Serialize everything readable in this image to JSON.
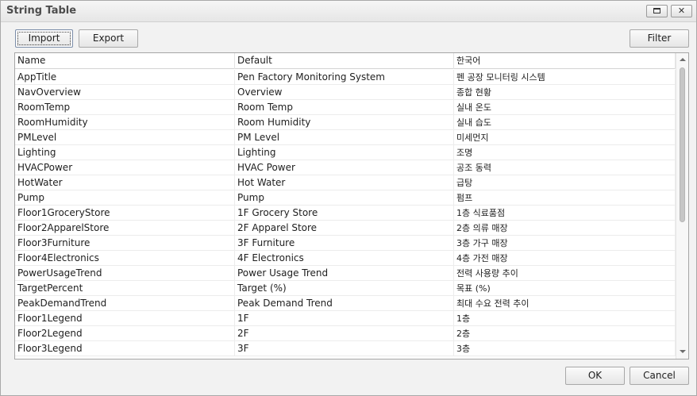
{
  "window": {
    "title": "String Table"
  },
  "toolbar": {
    "import_label": "Import",
    "export_label": "Export",
    "filter_label": "Filter"
  },
  "footer": {
    "ok_label": "OK",
    "cancel_label": "Cancel"
  },
  "table": {
    "columns": [
      "Name",
      "Default",
      "한국어"
    ],
    "rows": [
      [
        "AppTitle",
        "Pen Factory Monitoring System",
        "펜 공장 모니터링 시스템"
      ],
      [
        "NavOverview",
        "Overview",
        "종합 현황"
      ],
      [
        "RoomTemp",
        "Room Temp",
        "실내 온도"
      ],
      [
        "RoomHumidity",
        "Room Humidity",
        "실내 습도"
      ],
      [
        "PMLevel",
        "PM Level",
        "미세먼지"
      ],
      [
        "Lighting",
        "Lighting",
        "조명"
      ],
      [
        "HVACPower",
        "HVAC Power",
        "공조 동력"
      ],
      [
        "HotWater",
        "Hot Water",
        "급탕"
      ],
      [
        "Pump",
        "Pump",
        "펌프"
      ],
      [
        "Floor1GroceryStore",
        "1F Grocery Store",
        "1층 식료품점"
      ],
      [
        "Floor2ApparelStore",
        "2F Apparel Store",
        "2층 의류 매장"
      ],
      [
        "Floor3Furniture",
        "3F Furniture",
        "3층 가구 매장"
      ],
      [
        "Floor4Electronics",
        "4F Electronics",
        "4층 가전 매장"
      ],
      [
        "PowerUsageTrend",
        "Power Usage Trend",
        "전력 사용량 추이"
      ],
      [
        "TargetPercent",
        "Target (%)",
        "목표 (%)"
      ],
      [
        "PeakDemandTrend",
        "Peak Demand Trend",
        "최대 수요 전력 추이"
      ],
      [
        "Floor1Legend",
        "1F",
        "1층"
      ],
      [
        "Floor2Legend",
        "2F",
        "2층"
      ],
      [
        "Floor3Legend",
        "3F",
        "3층"
      ]
    ]
  }
}
